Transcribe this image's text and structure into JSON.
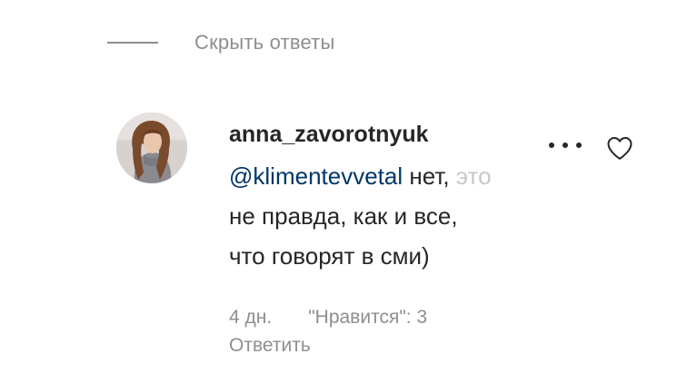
{
  "replies_toggle": {
    "label": "Скрыть ответы"
  },
  "comment": {
    "username": "anna_zavorotnyuk",
    "mention": "@klimentevvetal",
    "text_line1_visible": " нет, ",
    "text_line1_faded": "это",
    "text_line2": "не правда, как и все,",
    "text_line3": "что говорят в сми)",
    "time": "4 дн.",
    "likes": "\"Нравится\": 3",
    "reply_label": "Ответить",
    "icons": {
      "more": "more-horizontal-icon",
      "like": "heart-outline-icon"
    }
  },
  "colors": {
    "mention": "#00376b",
    "secondary_text": "#8e8e8e",
    "primary_text": "#262626"
  }
}
